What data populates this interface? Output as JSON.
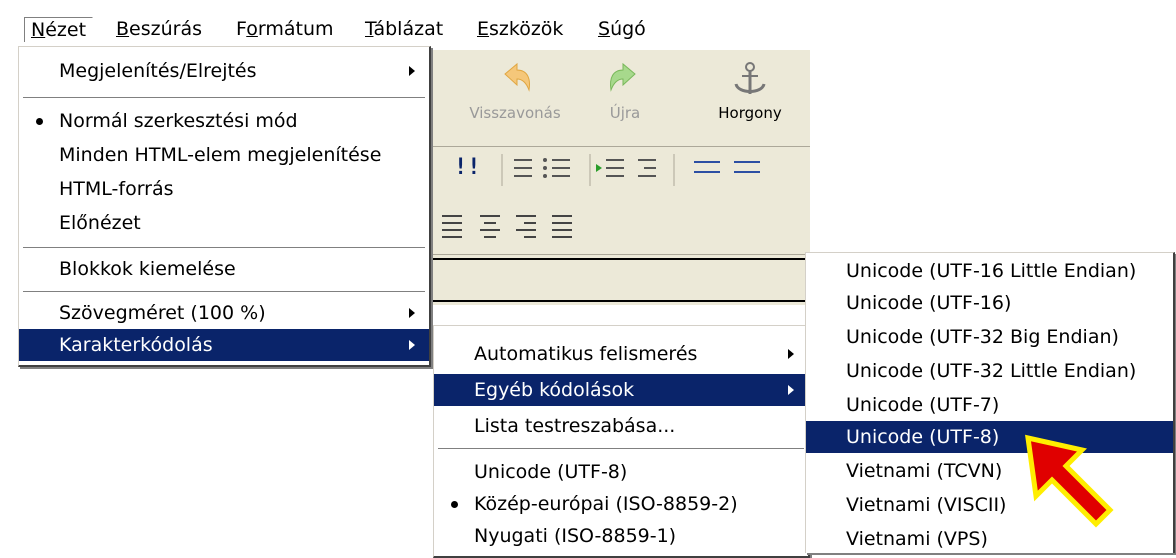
{
  "menubar": {
    "items": [
      {
        "label": "Nézet",
        "accel_index": 0
      },
      {
        "label": "Beszúrás",
        "accel_index": 0
      },
      {
        "label": "Formátum",
        "accel_index": 1
      },
      {
        "label": "Táblázat",
        "accel_index": 0
      },
      {
        "label": "Eszközök",
        "accel_index": 0
      },
      {
        "label": "Súgó",
        "accel_index": 0
      }
    ]
  },
  "toolbar": {
    "undo_label": "Visszavonás",
    "redo_label": "Újra",
    "anchor_label": "Horgony"
  },
  "view_menu": {
    "items": [
      {
        "label": "Megjelenítés/Elrejtés",
        "submenu": true
      },
      {
        "label": "Normál szerkesztési mód",
        "checked": true
      },
      {
        "label": "Minden HTML-elem megjelenítése"
      },
      {
        "label": "HTML-forrás"
      },
      {
        "label": "Előnézet"
      },
      {
        "label": "Blokkok kiemelése"
      },
      {
        "label": "Szövegméret (100 %)",
        "submenu": true
      },
      {
        "label": "Karakterkódolás",
        "submenu": true,
        "selected": true
      }
    ]
  },
  "encoding_menu": {
    "items": [
      {
        "label": "Automatikus felismerés",
        "submenu": true
      },
      {
        "label": "Egyéb kódolások",
        "submenu": true,
        "selected": true
      },
      {
        "label": "Lista testreszabása..."
      },
      {
        "label": "Unicode (UTF-8)"
      },
      {
        "label": "Közép-európai (ISO-8859-2)",
        "checked": true
      },
      {
        "label": "Nyugati (ISO-8859-1)"
      }
    ]
  },
  "other_encodings_menu": {
    "items": [
      {
        "label": "Unicode (UTF-16 Little Endian)"
      },
      {
        "label": "Unicode (UTF-16)"
      },
      {
        "label": "Unicode (UTF-32 Big Endian)"
      },
      {
        "label": "Unicode (UTF-32 Little Endian)"
      },
      {
        "label": "Unicode (UTF-7)"
      },
      {
        "label": "Unicode (UTF-8)",
        "selected": true
      },
      {
        "label": "Vietnami (TCVN)"
      },
      {
        "label": "Vietnami (VISCII)"
      },
      {
        "label": "Vietnami (VPS)"
      }
    ]
  },
  "colors": {
    "selection": "#0a246a",
    "arrow_fill": "#e00000",
    "arrow_outline": "#ffee00"
  }
}
